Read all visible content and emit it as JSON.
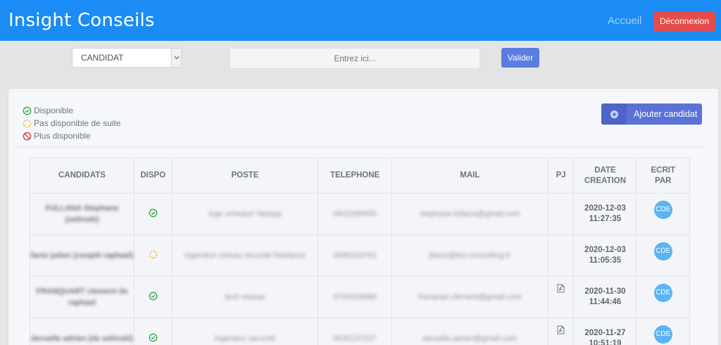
{
  "header": {
    "brand": "Insight Conseils",
    "home_link": "Accueil",
    "logout_label": "Déconnexion",
    "colors": {
      "navbar": "#1b8cf5",
      "logout": "#e74c4c"
    }
  },
  "search": {
    "filter_selected": "CANDIDAT",
    "placeholder": "Entrez ici...",
    "submit_label": "Valider"
  },
  "legend": [
    {
      "icon": "check-circle-icon",
      "label": "Disponible"
    },
    {
      "icon": "spinner-icon",
      "label": "Pas disponible de suite"
    },
    {
      "icon": "ban-icon",
      "label": "Plus disponible"
    }
  ],
  "add_candidate_label": "Ajouter candidat",
  "table": {
    "columns": [
      "CANDIDATS",
      "DISPO",
      "POSTE",
      "TELEPHONE",
      "MAIL",
      "PJ",
      "DATE CREATION",
      "ECRIT PAR"
    ],
    "rows": [
      {
        "name": "FULLANA Stephane (selinski)",
        "dispo": "available",
        "poste": "inge vmware/ Netapp",
        "telephone": "0631589555",
        "mail": "stephane.fullana@gmail.com",
        "pj": false,
        "date": "2020-12-03",
        "time": "11:27:35",
        "author": "CDE"
      },
      {
        "name": "farez julien (cooptè raphael)",
        "dispo": "pending",
        "poste": "ingenieur reseau securité freelance",
        "telephone": "0688319761",
        "mail": "jfarez@fez-consulting.fr",
        "pj": false,
        "date": "2020-12-03",
        "time": "11:05:35",
        "author": "CDE"
      },
      {
        "name": "FRANQUART clement de raphael",
        "dispo": "available",
        "poste": "tech reseau",
        "telephone": "0764163686",
        "mail": "franquart.clement@gmail.com",
        "pj": true,
        "date": "2020-11-30",
        "time": "11:44:46",
        "author": "CDE"
      },
      {
        "name": "deruelle adrien (de selinski)",
        "dispo": "available",
        "poste": "ingenieur securité",
        "telephone": "0635137237",
        "mail": "deruelle.adrien@gmail.com",
        "pj": true,
        "date": "2020-11-27",
        "time": "10:51:19",
        "author": "CDE"
      }
    ]
  }
}
